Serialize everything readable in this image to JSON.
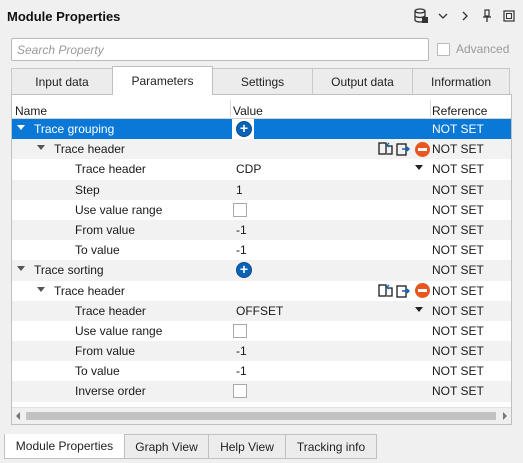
{
  "window": {
    "title": "Module Properties"
  },
  "toolbar_icons": [
    "database-icon",
    "chevron-down-icon",
    "chevron-right-icon",
    "pin-icon",
    "maximize-icon"
  ],
  "search": {
    "placeholder": "Search Property",
    "value": ""
  },
  "advanced": {
    "label": "Advanced",
    "checked": false
  },
  "tabs": [
    {
      "label": "Input data",
      "active": false
    },
    {
      "label": "Parameters",
      "active": true
    },
    {
      "label": "Settings",
      "active": false
    },
    {
      "label": "Output data",
      "active": false
    },
    {
      "label": "Information",
      "active": false
    }
  ],
  "columns": {
    "name": "Name",
    "value": "Value",
    "reference": "Reference"
  },
  "rows": [
    {
      "name": "Trace grouping",
      "ref": "NOT SET",
      "selected": true,
      "expander": true,
      "control": "add-button"
    },
    {
      "name": "Trace header",
      "ref": "NOT SET",
      "expander": true,
      "control": "row-actions"
    },
    {
      "name": "Trace header",
      "value": "CDP",
      "ref": "NOT SET",
      "control": "dropdown"
    },
    {
      "name": "Step",
      "value": "1",
      "ref": "NOT SET"
    },
    {
      "name": "Use value range",
      "ref": "NOT SET",
      "control": "checkbox",
      "checked": false
    },
    {
      "name": "From value",
      "value": "-1",
      "ref": "NOT SET"
    },
    {
      "name": "To value",
      "value": "-1",
      "ref": "NOT SET"
    },
    {
      "name": "Trace sorting",
      "ref": "NOT SET",
      "expander": true,
      "control": "add-button"
    },
    {
      "name": "Trace header",
      "ref": "NOT SET",
      "expander": true,
      "control": "row-actions"
    },
    {
      "name": "Trace header",
      "value": "OFFSET",
      "ref": "NOT SET",
      "control": "dropdown"
    },
    {
      "name": "Use value range",
      "ref": "NOT SET",
      "control": "checkbox",
      "checked": false
    },
    {
      "name": "From value",
      "value": "-1",
      "ref": "NOT SET"
    },
    {
      "name": "To value",
      "value": "-1",
      "ref": "NOT SET"
    },
    {
      "name": "Inverse order",
      "ref": "NOT SET",
      "control": "checkbox",
      "checked": false
    }
  ],
  "bottom_tabs": [
    {
      "label": "Module Properties",
      "active": true
    },
    {
      "label": "Graph View",
      "active": false
    },
    {
      "label": "Help View",
      "active": false
    },
    {
      "label": "Tracking info",
      "active": false
    }
  ],
  "colors": {
    "selection": "#0a78d7",
    "add_icon": "#0b63b8",
    "remove_icon": "#e8571f"
  }
}
